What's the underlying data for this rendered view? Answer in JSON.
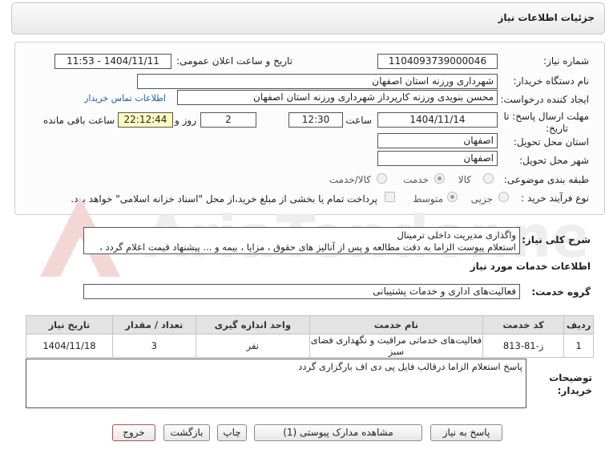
{
  "header": {
    "title": "جزئیات اطلاعات نیاز"
  },
  "labels": {
    "need_number": "شماره نیاز:",
    "announce_datetime": "تاریخ و ساعت اعلان عمومی:",
    "buyer_org": "نام دستگاه خریدار:",
    "requester": "ایجاد کننده درخواست:",
    "deadline": "مهلت ارسال پاسخ: تا تاریخ:",
    "hour": "ساعت",
    "day_and": "روز و",
    "hours_left": "ساعت باقی مانده",
    "province": "استان محل تحویل:",
    "city": "شهر محل تحویل:",
    "category": "طبقه بندی موضوعی:",
    "process_type": "نوع فرآیند خرید :",
    "general_desc": "شرح کلی نیاز:",
    "services_info": "اطلاعات خدمات مورد نیاز",
    "service_group": "گروه خدمت:",
    "buyer_notes": "توضیحات خریدار:"
  },
  "fields": {
    "need_number": "1104093739000046",
    "announce_datetime": "1404/11/11 - 11:53",
    "buyer_org": "شهرداری ورزنه استان اصفهان",
    "requester": "محسن بنویدی ورزنه کارپرداز شهرداری ورزنه استان اصفهان",
    "deadline_date": "1404/11/14",
    "deadline_time": "12:30",
    "days_left": "2",
    "time_left": "22:12:44",
    "province": "اصفهان",
    "city": "اصفهان",
    "general_desc_line1": "واگذاری مدیریت داخلی ترمینال",
    "general_desc_line2": "استعلام پیوست الزاما به دقت مطالعه و پس از آنالیز های حقوق ، مزایا ، بیمه و ... پیشنهاد قیمت اعلام گردد ،",
    "service_group": "فعالیت‌های اداری و خدمات پشتیبانی",
    "buyer_notes": "پاسخ استعلام الزاما درقالب فایل پی دی اف بارگزاری گردد"
  },
  "links": {
    "buyer_contact": "اطلاعات تماس خریدار"
  },
  "category_options": [
    {
      "label": "کالا",
      "selected": false
    },
    {
      "label": "خدمت",
      "selected": true
    },
    {
      "label": "کالا/خدمت",
      "selected": false
    }
  ],
  "process_options": [
    {
      "label": "جزیی",
      "selected": false
    },
    {
      "label": "متوسط",
      "selected": true
    }
  ],
  "payment_note": "پرداخت تمام یا بخشی از مبلغ خرید،از محل \"اسناد خزانه اسلامی\" خواهد بود.",
  "table": {
    "headers": [
      "ردیف",
      "کد خدمت",
      "نام خدمت",
      "واحد اندازه گیری",
      "تعداد / مقدار",
      "تاریخ نیاز"
    ],
    "rows": [
      [
        "1",
        "ز-81-813",
        "فعالیت‌های خدماتی مراقبت و نگهداری فضای سبز",
        "نفر",
        "3",
        "1404/11/18"
      ]
    ]
  },
  "buttons": {
    "reply": "پاسخ به نیاز",
    "attachments": "مشاهده مدارک پیوستی (1)",
    "print": "چاپ",
    "back": "بازگشت",
    "exit": "خروج"
  },
  "watermark": "AriaTender.net",
  "colors": {
    "link": "#1a5fb4",
    "countdown_bg": "#fffcc0",
    "exit_border": "#c04a4a"
  }
}
